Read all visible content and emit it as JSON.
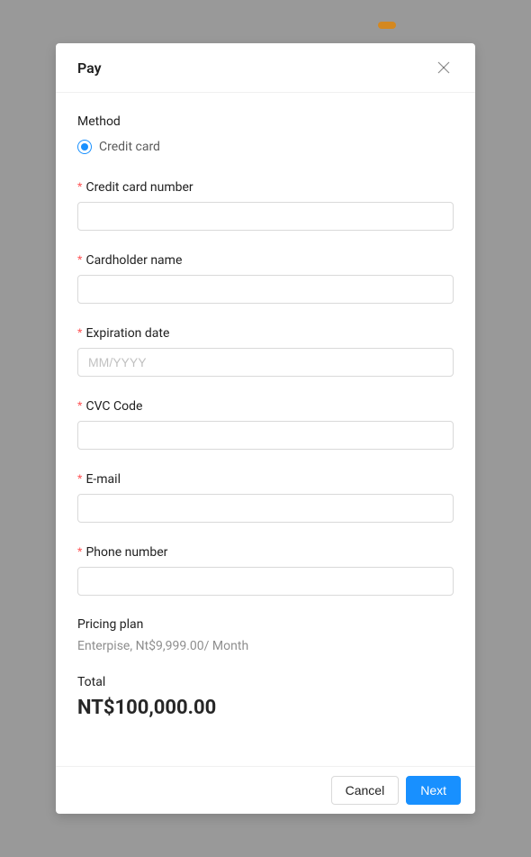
{
  "modal": {
    "title": "Pay"
  },
  "method": {
    "label": "Method",
    "option1": "Credit card"
  },
  "fields": {
    "cardNumber": {
      "label": "Credit card number"
    },
    "cardholderName": {
      "label": "Cardholder name"
    },
    "expirationDate": {
      "label": "Expiration date",
      "placeholder": "MM/YYYY"
    },
    "cvc": {
      "label": "CVC Code"
    },
    "email": {
      "label": "E-mail"
    },
    "phone": {
      "label": "Phone number"
    }
  },
  "pricingPlan": {
    "label": "Pricing plan",
    "value": "Enterpise, Nt$9,999.00/ Month"
  },
  "total": {
    "label": "Total",
    "value": "NT$100,000.00"
  },
  "footer": {
    "cancel": "Cancel",
    "next": "Next"
  }
}
